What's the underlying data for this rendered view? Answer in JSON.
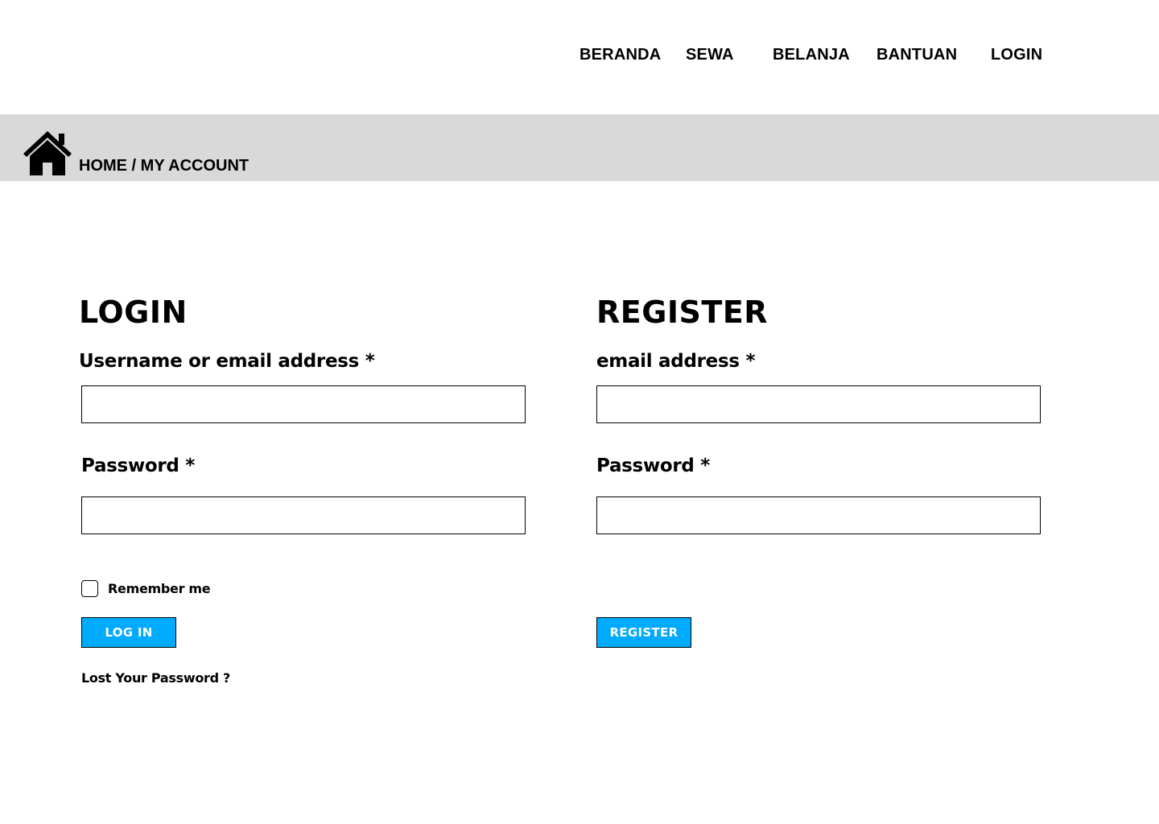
{
  "nav": {
    "items": [
      {
        "label": "BERANDA"
      },
      {
        "label": "SEWA"
      },
      {
        "label": "BELANJA"
      },
      {
        "label": "BANTUAN"
      },
      {
        "label": "LOGIN"
      }
    ]
  },
  "breadcrumb": {
    "icon": "home-icon",
    "home": "HOME",
    "separator": " / ",
    "current": "MY ACCOUNT"
  },
  "login": {
    "title": "LOGIN",
    "username_label": "Username or email address *",
    "username_value": "",
    "password_label": "Password *",
    "password_value": "",
    "remember_label": "Remember me",
    "remember_checked": false,
    "submit_label": "LOG IN",
    "lost_password": "Lost Your Password ?"
  },
  "register": {
    "title": "REGISTER",
    "email_label": "email address *",
    "email_value": "",
    "password_label": "Password *",
    "password_value": "",
    "submit_label": "REGISTER"
  },
  "colors": {
    "accent": "#00aaff",
    "breadcrumb_bg": "#d9d9d9",
    "text": "#000000"
  }
}
